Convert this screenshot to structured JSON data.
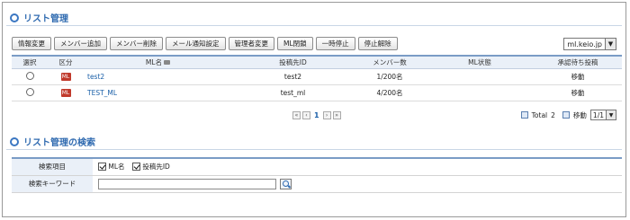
{
  "list_section": {
    "title": "リスト管理",
    "toolbar": [
      "情報変更",
      "メンバー追加",
      "メンバー削除",
      "メール通知設定",
      "管理者変更",
      "ML閉鎖",
      "一時停止",
      "停止解除"
    ],
    "domain": "ml.keio.jp",
    "columns": [
      "選択",
      "区分",
      "ML名",
      "投稿先ID",
      "メンバー数",
      "ML状態",
      "承認待ち投稿"
    ],
    "rows": [
      {
        "type": "ML",
        "name": "test2",
        "post_id": "test2",
        "members": "1/200名",
        "status": "",
        "pending": "移動"
      },
      {
        "type": "ML",
        "name": "TEST_ML",
        "post_id": "test_ml",
        "members": "4/200名",
        "status": "",
        "pending": "移動"
      }
    ],
    "pager": {
      "current": "1"
    },
    "total_label": "Total",
    "total_count": "2",
    "move_label": "移動",
    "page_select": "1/1"
  },
  "search_section": {
    "title": "リスト管理の検索",
    "item_label": "検索項目",
    "checkbox_ml": "ML名",
    "checkbox_post": "投稿先ID",
    "keyword_label": "検索キーワード",
    "keyword_value": ""
  }
}
